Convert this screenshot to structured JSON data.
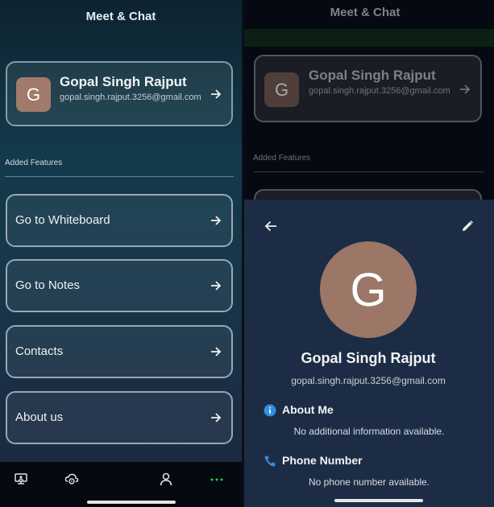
{
  "app": {
    "title": "Meet & Chat"
  },
  "profile": {
    "initial": "G",
    "name": "Gopal Singh Rajput",
    "email": "gopal.singh.rajput.3256@gmail.com"
  },
  "features": {
    "section_label": "Added Features",
    "items": [
      {
        "label": "Go to Whiteboard"
      },
      {
        "label": "Go to Notes"
      },
      {
        "label": "Contacts"
      },
      {
        "label": "About us"
      }
    ]
  },
  "bottom_nav": {
    "icons": [
      "meeting-icon",
      "cloud-icon",
      "profile-icon",
      "more-icon"
    ],
    "active_color": "#2ecc40"
  },
  "profile_sheet": {
    "initial": "G",
    "name": "Gopal Singh Rajput",
    "email": "gopal.singh.rajput.3256@gmail.com",
    "about_heading": "About Me",
    "about_text": "No additional information available.",
    "phone_heading": "Phone Number",
    "phone_text": "No phone number available.",
    "accent_color": "#2f8fe0"
  }
}
